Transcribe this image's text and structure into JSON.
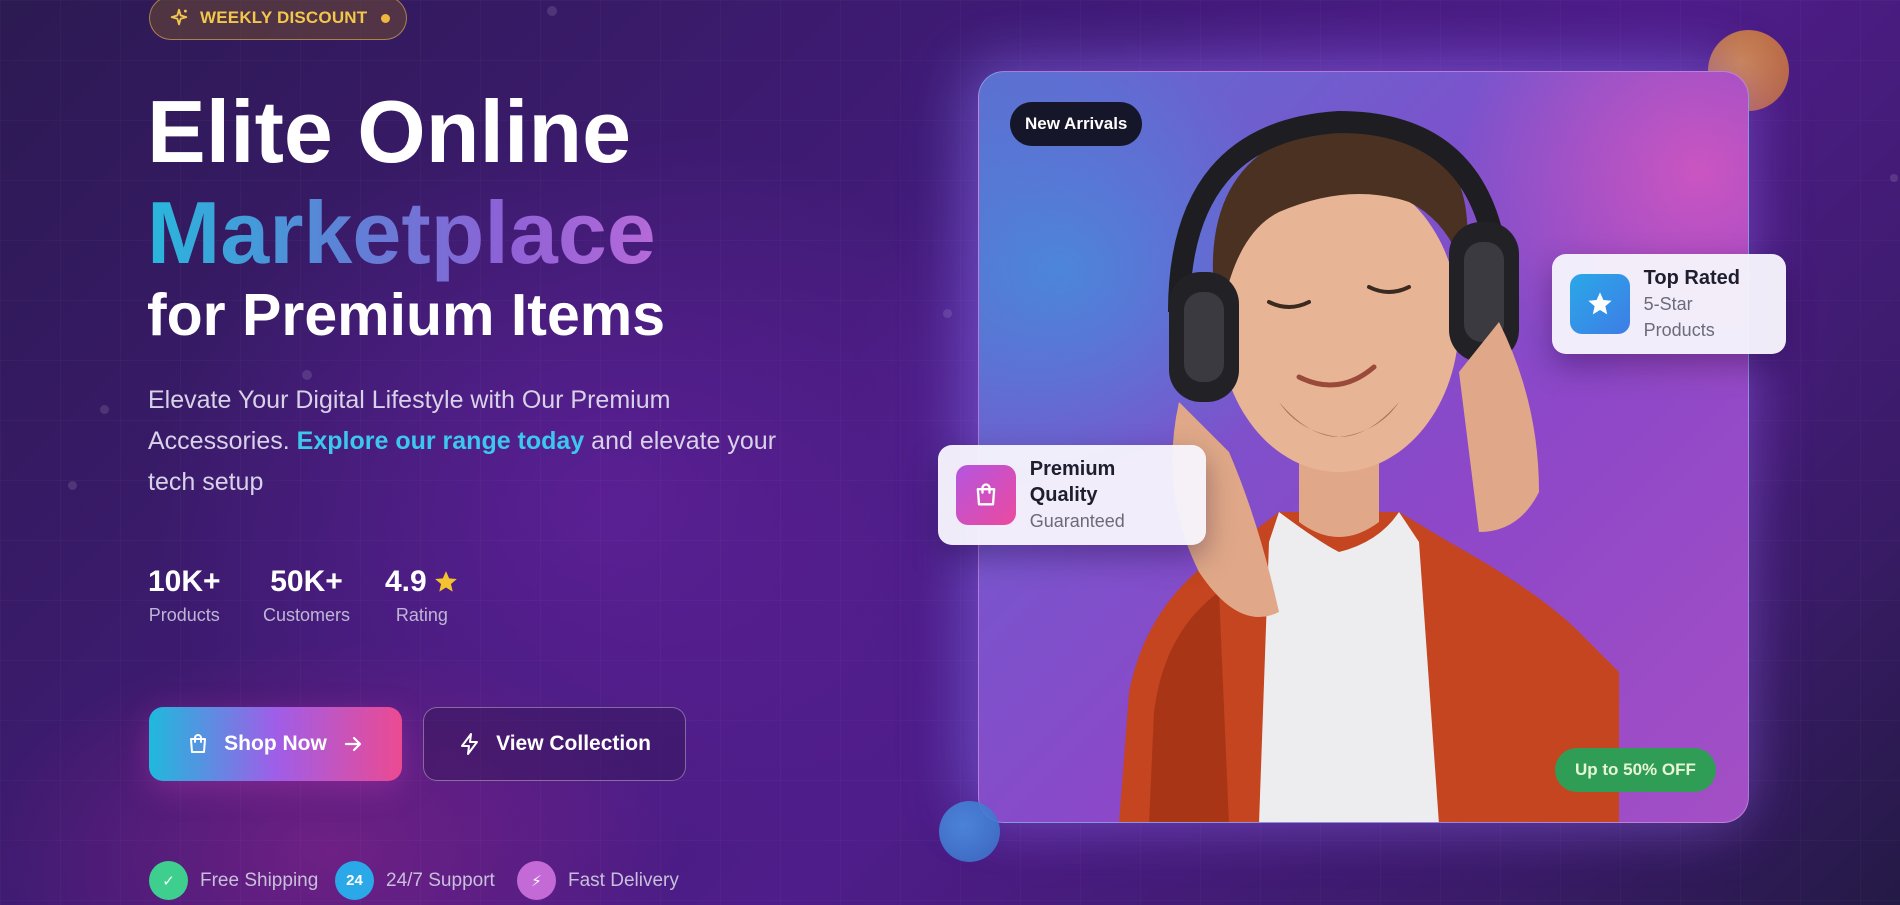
{
  "hero": {
    "badge_label": "WEEKLY DISCOUNT",
    "title_line1": "Elite Online",
    "title_line2": "Marketplace",
    "title_line3": "for Premium Items",
    "desc_part1": "Elevate Your Digital Lifestyle with Our Premium Accessories. ",
    "desc_highlight": "Explore our range today",
    "desc_part2": " and elevate your tech setup"
  },
  "stats": [
    {
      "value": "10K+",
      "label": "Products"
    },
    {
      "value": "50K+",
      "label": "Customers"
    },
    {
      "value": "4.9",
      "label": "Rating",
      "icon": "star-icon"
    }
  ],
  "buttons": {
    "shop_label": "Shop Now",
    "view_label": "View Collection"
  },
  "features": [
    {
      "icon_text": "✓",
      "label": "Free Shipping",
      "icon": "check-icon",
      "color": "#3ecf8e"
    },
    {
      "icon_text": "24",
      "label": "24/7 Support",
      "icon": "support-icon",
      "color": "#2aa8e8"
    },
    {
      "icon_text": "⚡",
      "label": "Fast Delivery",
      "icon": "lightning-icon",
      "color": "#c46ad6"
    }
  ],
  "image_card": {
    "tag": "New Arrivals",
    "discount": "Up to 50% OFF",
    "quality_title": "Premium Quality",
    "quality_sub": "Guaranteed",
    "rated_title": "Top Rated",
    "rated_sub": "5-Star Products"
  },
  "colors": {
    "accent_cyan": "#3cc8ee",
    "accent_pink": "#ec4a92",
    "gold": "#f3c64c",
    "green": "#2f9d55"
  }
}
